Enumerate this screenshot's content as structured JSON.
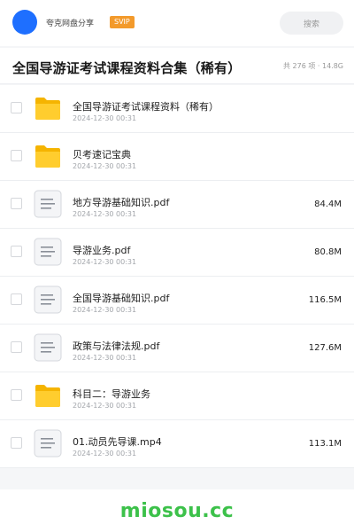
{
  "header": {
    "user_name": "夸克网盘分享",
    "badge": "SVIP",
    "search_placeholder": "搜索",
    "avatar_color": "#1e6fff",
    "badge_color": "#f39a2b"
  },
  "share": {
    "title": "全国导游证考试课程资料合集（稀有）",
    "summary": "共 276 项 · 14.8G"
  },
  "files": [
    {
      "type": "folder",
      "name": "全国导游证考试课程资料（稀有）",
      "date": "2024-12-30 00:31",
      "size": ""
    },
    {
      "type": "folder",
      "name": "贝考速记宝典",
      "date": "2024-12-30 00:31",
      "size": ""
    },
    {
      "type": "file",
      "name": "地方导游基础知识.pdf",
      "date": "2024-12-30 00:31",
      "size": "84.4M"
    },
    {
      "type": "file",
      "name": "导游业务.pdf",
      "date": "2024-12-30 00:31",
      "size": "80.8M"
    },
    {
      "type": "file",
      "name": "全国导游基础知识.pdf",
      "date": "2024-12-30 00:31",
      "size": "116.5M"
    },
    {
      "type": "file",
      "name": "政策与法律法规.pdf",
      "date": "2024-12-30 00:31",
      "size": "127.6M"
    },
    {
      "type": "folder",
      "name": "科目二：导游业务",
      "date": "2024-12-30 00:31",
      "size": ""
    },
    {
      "type": "file",
      "name": "01.动员先导课.mp4",
      "date": "2024-12-30 00:31",
      "size": "113.1M"
    }
  ],
  "footer": {
    "watermark": "miosou.cc",
    "watermark_color": "#3cc14a"
  }
}
